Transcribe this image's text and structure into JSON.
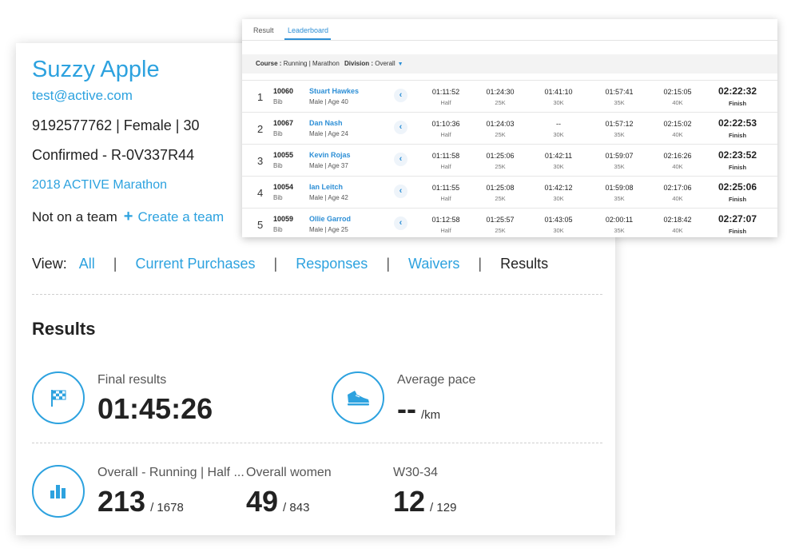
{
  "profile": {
    "name": "Suzzy Apple",
    "email": "test@active.com",
    "details": "9192577762 | Female | 30",
    "confirmation": "Confirmed - R-0V337R44",
    "event": "2018 ACTIVE Marathon",
    "team_status": "Not on a team",
    "create_team": "Create a team"
  },
  "view": {
    "label": "View:",
    "links": [
      "All",
      "Current Purchases",
      "Responses",
      "Waivers"
    ],
    "current": "Results",
    "separator": "|"
  },
  "results": {
    "title": "Results",
    "final_label": "Final results",
    "final_time": "01:45:26",
    "pace_label": "Average pace",
    "pace_value": "--",
    "pace_unit": "/km",
    "rankings": [
      {
        "label": "Overall - Running | Half ...",
        "rank": "213",
        "total": "/ 1678"
      },
      {
        "label": "Overall women",
        "rank": "49",
        "total": "/ 843"
      },
      {
        "label": "W30-34",
        "rank": "12",
        "total": "/ 129"
      }
    ]
  },
  "leaderboard": {
    "tabs": [
      "Result",
      "Leaderboard"
    ],
    "active_tab": "Leaderboard",
    "course_label": "Course :",
    "course_value": "Running | Marathon",
    "division_label": "Division :",
    "division_value": "Overall",
    "bib_label": "Bib",
    "split_labels": [
      "Half",
      "25K",
      "30K",
      "35K",
      "40K"
    ],
    "finish_label": "Finish",
    "rows": [
      {
        "rank": "1",
        "bib": "10060",
        "name": "Stuart Hawkes",
        "meta": "Male | Age 40",
        "splits": [
          "01:11:52",
          "01:24:30",
          "01:41:10",
          "01:57:41",
          "02:15:05"
        ],
        "finish": "02:22:32"
      },
      {
        "rank": "2",
        "bib": "10067",
        "name": "Dan Nash",
        "meta": "Male | Age 24",
        "splits": [
          "01:10:36",
          "01:24:03",
          "--",
          "01:57:12",
          "02:15:02"
        ],
        "finish": "02:22:53"
      },
      {
        "rank": "3",
        "bib": "10055",
        "name": "Kevin Rojas",
        "meta": "Male | Age 37",
        "splits": [
          "01:11:58",
          "01:25:06",
          "01:42:11",
          "01:59:07",
          "02:16:26"
        ],
        "finish": "02:23:52"
      },
      {
        "rank": "4",
        "bib": "10054",
        "name": "Ian Leitch",
        "meta": "Male | Age 42",
        "splits": [
          "01:11:55",
          "01:25:08",
          "01:42:12",
          "01:59:08",
          "02:17:06"
        ],
        "finish": "02:25:06"
      },
      {
        "rank": "5",
        "bib": "10059",
        "name": "Ollie Garrod",
        "meta": "Male | Age 25",
        "splits": [
          "01:12:58",
          "01:25:57",
          "01:43:05",
          "02:00:11",
          "02:18:42"
        ],
        "finish": "02:27:07"
      }
    ]
  },
  "colors": {
    "accent": "#2da2df",
    "link": "#2d8fd6",
    "text": "#222222"
  },
  "icons": {
    "final": "checkered-flag-icon",
    "pace": "running-shoe-icon",
    "rank": "bar-chart-icon",
    "row_expand": "chevron-left-icon",
    "division_dropdown": "caret-down-icon"
  }
}
